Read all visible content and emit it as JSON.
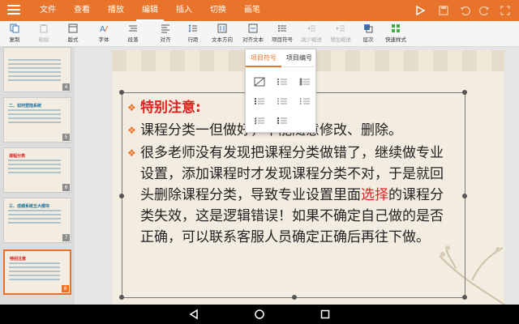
{
  "menu": {
    "tabs": [
      {
        "label": "文件"
      },
      {
        "label": "查看"
      },
      {
        "label": "播放"
      },
      {
        "label": "编辑"
      },
      {
        "label": "插入"
      },
      {
        "label": "切换"
      },
      {
        "label": "画笔"
      }
    ],
    "active_tab": "编辑"
  },
  "toolbar": {
    "items": [
      {
        "label": "复制",
        "icon": "copy-icon"
      },
      {
        "label": "粘贴",
        "icon": "paste-icon",
        "disabled": true
      },
      {
        "label": "版式",
        "icon": "layout-icon"
      },
      {
        "label": "字体",
        "icon": "font-icon"
      },
      {
        "label": "段落",
        "icon": "paragraph-icon"
      },
      {
        "label": "对齐",
        "icon": "align-icon"
      },
      {
        "label": "行距",
        "icon": "line-spacing-icon"
      },
      {
        "label": "文本方向",
        "icon": "text-direction-icon"
      },
      {
        "label": "对齐文本",
        "icon": "align-text-icon"
      },
      {
        "label": "项目符号",
        "icon": "bullets-icon"
      },
      {
        "label": "减少缩进",
        "icon": "decrease-indent-icon",
        "disabled": true
      },
      {
        "label": "增加缩进",
        "icon": "increase-indent-icon",
        "disabled": true
      },
      {
        "label": "层次",
        "icon": "layer-icon"
      },
      {
        "label": "快速样式",
        "icon": "quick-style-icon"
      }
    ]
  },
  "sidebar": {
    "slides": [
      {
        "number": "4",
        "title": ""
      },
      {
        "number": "5",
        "title": "二、如何登陆系统"
      },
      {
        "number": "6",
        "title": "课程分类"
      },
      {
        "number": "7",
        "title": "三、成绩系统五大模块"
      },
      {
        "number": "8",
        "title": "特别注意",
        "active": true
      }
    ]
  },
  "slide": {
    "title": "特别注意:",
    "bullet2": "课程分类一但做好，不能随意修改、删除。",
    "bullet3_lines": [
      "很多老师没有发现把课程分类做错了，继续做专业",
      "设置，添加课程时才发现课程分类不对，于是就回"
    ],
    "bullet3_line3_pre": "头删除课程分类，导致专业设置里面",
    "bullet3_line3_red": "选择",
    "bullet3_line3_post": "的课程分",
    "bullet3_lines_tail": [
      "类失效，这是逻辑错误！如果不确定自己做的是否",
      "正确，可以联系客服人员确定正确后再往下做。"
    ]
  },
  "popup": {
    "tab1": "项目符号",
    "tab2": "项目编号"
  },
  "colors": {
    "accent": "#e8742c",
    "title_red": "#e02020"
  }
}
